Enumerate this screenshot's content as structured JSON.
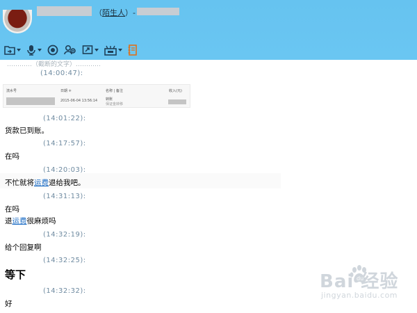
{
  "header": {
    "title_open": "（",
    "title_stranger": "陌生人",
    "title_close": "）-"
  },
  "toolbar": {
    "items": [
      {
        "icon": "folder-share-icon",
        "has_menu": true
      },
      {
        "icon": "microphone-icon",
        "has_menu": true
      },
      {
        "icon": "camera-icon",
        "has_menu": false
      },
      {
        "icon": "contacts-icon",
        "has_menu": false
      },
      {
        "icon": "screen-share-icon",
        "has_menu": true
      },
      {
        "icon": "remote-assist-icon",
        "has_menu": true
      },
      {
        "icon": "notebook-icon",
        "has_menu": false
      }
    ]
  },
  "chat": {
    "cut_text": "…………（截断的文字）…………",
    "messages": [
      {
        "time": "(14:00:47):"
      },
      {
        "time": "(14:01:22):",
        "text": "货款已到账。"
      },
      {
        "time": "(14:17:57):",
        "text": "在吗"
      },
      {
        "time": "(14:20:03):",
        "text_before": "不忙就将",
        "link": "运费",
        "text_after": "退给我吧。"
      },
      {
        "time": "(14:31:13):",
        "text": "在吗",
        "text2_before": "退",
        "text2_link": "运费",
        "text2_after": "很麻烦吗"
      },
      {
        "time": "(14:32:19):",
        "text": "给个回复啊"
      },
      {
        "time": "(14:32:25):",
        "text": "等下"
      },
      {
        "time": "(14:32:32):",
        "text": "好"
      }
    ],
    "card": {
      "col_serial": "流水号",
      "col_date": "日期 ≑",
      "col_name": "名称 | 备注",
      "col_income": "收入(元)",
      "date": "2015-06-04 13:56:14",
      "name": "转账",
      "note": "保证金转移"
    }
  },
  "watermark": {
    "logo": "Bai  经验",
    "url": "jingyan.baidu.com"
  },
  "colors": {
    "header_bg": "#66c3f0",
    "link": "#1a6bc4",
    "timestamp": "#6e8aa0"
  }
}
